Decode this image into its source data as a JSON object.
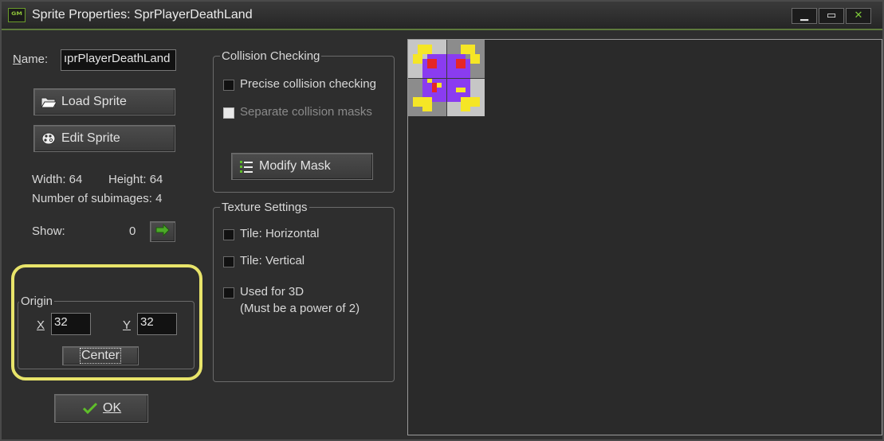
{
  "window": {
    "title": "Sprite Properties: SprPlayerDeathLand",
    "icon_text": "ᴳᴹ",
    "controls": {
      "minimize": "▁",
      "maximize": "▭",
      "close": "✕"
    }
  },
  "name_field": {
    "label": "Name:",
    "value": "SprPlayerDeathLand",
    "displayed_value": "ıprPlayerDeathLand"
  },
  "buttons": {
    "load_sprite": "Load Sprite",
    "edit_sprite": "Edit Sprite",
    "modify_mask": "Modify Mask",
    "center": "Center",
    "ok": "OK"
  },
  "info": {
    "width_text": "Width: 64",
    "height_text": "Height: 64",
    "subimages_text": "Number of subimages: 4"
  },
  "show": {
    "label": "Show:",
    "value": "0"
  },
  "origin": {
    "group_label": "Origin",
    "x_label": "X",
    "x_value": "32",
    "y_label": "Y",
    "y_value": "32"
  },
  "collision": {
    "group_label": "Collision Checking",
    "precise_label": "Precise collision checking",
    "precise_checked": false,
    "separate_label": "Separate collision masks",
    "separate_enabled": false
  },
  "texture": {
    "group_label": "Texture Settings",
    "tile_h_label": "Tile: Horizontal",
    "tile_v_label": "Tile: Vertical",
    "used_3d_label": "Used for 3D",
    "used_3d_note": "(Must be a power of 2)"
  },
  "colors": {
    "accent_green": "#7ec93a",
    "highlight": "#e8e46a",
    "sprite_purple": "#8a3cf0",
    "sprite_yellow": "#f5e626",
    "sprite_red": "#e62626",
    "checker_light": "#c6c6c6",
    "checker_dark": "#8c8c8c"
  }
}
